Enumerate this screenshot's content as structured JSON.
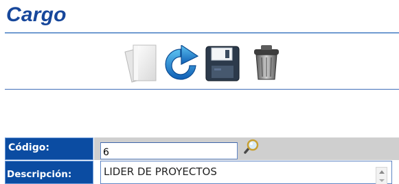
{
  "header": {
    "title": "Cargo"
  },
  "toolbar": {
    "buttons": [
      {
        "name": "new",
        "icon": "new-document-icon"
      },
      {
        "name": "refresh",
        "icon": "refresh-icon"
      },
      {
        "name": "save",
        "icon": "floppy-disk-icon"
      },
      {
        "name": "delete",
        "icon": "trash-can-icon"
      }
    ]
  },
  "form": {
    "codigo": {
      "label": "Código:",
      "value": "6"
    },
    "descripcion": {
      "label": "Descripción:",
      "value": "LIDER DE PROYECTOS"
    }
  },
  "colors": {
    "title": "#17479b",
    "label_bg": "#0b4ca2",
    "rule": "#6f9ad0",
    "row_strip": "#cfcfcf"
  }
}
